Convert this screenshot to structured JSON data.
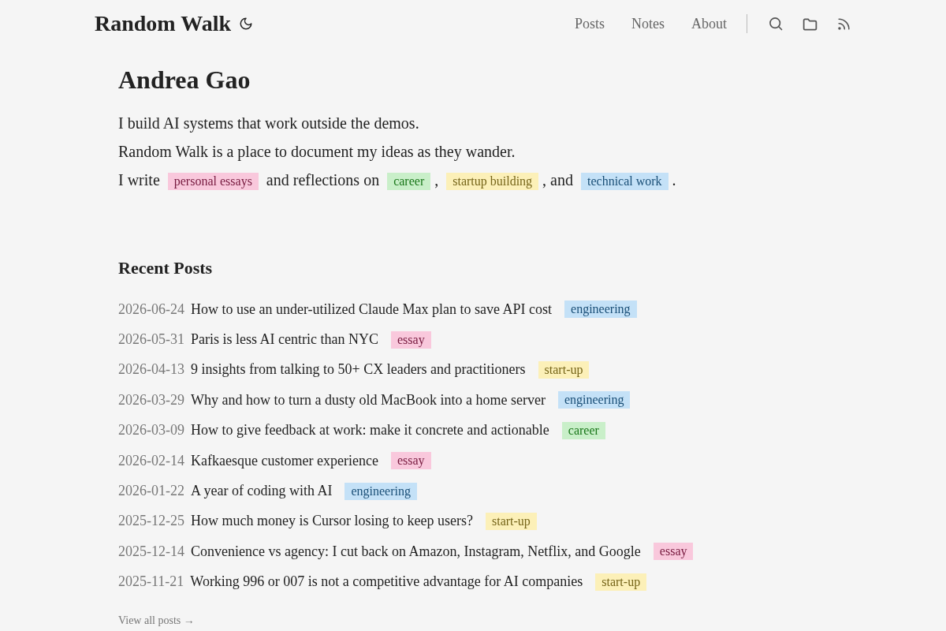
{
  "header": {
    "brand": "Random Walk",
    "nav": [
      {
        "label": "Posts"
      },
      {
        "label": "Notes"
      },
      {
        "label": "About"
      }
    ]
  },
  "profile": {
    "name": "Andrea Gao",
    "intro": [
      {
        "parts": [
          {
            "kind": "text",
            "text": "I build AI systems that work outside the demos."
          }
        ]
      },
      {
        "parts": [
          {
            "kind": "text",
            "text": "Random Walk is a place to document my ideas as they wander."
          }
        ]
      },
      {
        "parts": [
          {
            "kind": "text",
            "text": "I write "
          },
          {
            "kind": "tag",
            "text": "personal essays",
            "color": "#f9c8dc"
          },
          {
            "kind": "text",
            "text": " and reflections on "
          },
          {
            "kind": "tag",
            "text": "career",
            "color": "#c9efc9"
          },
          {
            "kind": "text",
            "text": ", "
          },
          {
            "kind": "tag",
            "text": "startup building",
            "color": "#fcf0b8"
          },
          {
            "kind": "text",
            "text": ", and "
          },
          {
            "kind": "tag",
            "text": "technical work",
            "color": "#c4e1f7"
          },
          {
            "kind": "text",
            "text": "."
          }
        ]
      }
    ]
  },
  "recent_posts": {
    "title": "Recent Posts",
    "posts": [
      {
        "date": "2026-06-24",
        "title": "How to use an under-utilized Claude Max plan to save API cost",
        "tag": {
          "text": "engineering",
          "color": "#c4e1f7"
        }
      },
      {
        "date": "2026-05-31",
        "title": "Paris is less AI centric than NYC",
        "tag": {
          "text": "essay",
          "color": "#f9c8dc"
        }
      },
      {
        "date": "2026-04-13",
        "title": "9 insights from talking to 50+ CX leaders and practitioners",
        "tag": {
          "text": "start-up",
          "color": "#fcf0b8"
        }
      },
      {
        "date": "2026-03-29",
        "title": "Why and how to turn a dusty old MacBook into a home server",
        "tag": {
          "text": "engineering",
          "color": "#c4e1f7"
        }
      },
      {
        "date": "2026-03-09",
        "title": "How to give feedback at work: make it concrete and actionable",
        "tag": {
          "text": "career",
          "color": "#c9efc9"
        }
      },
      {
        "date": "2026-02-14",
        "title": "Kafkaesque customer experience",
        "tag": {
          "text": "essay",
          "color": "#f9c8dc"
        }
      },
      {
        "date": "2026-01-22",
        "title": "A year of coding with AI",
        "tag": {
          "text": "engineering",
          "color": "#c4e1f7"
        }
      },
      {
        "date": "2025-12-25",
        "title": "How much money is Cursor losing to keep users?",
        "tag": {
          "text": "start-up",
          "color": "#fcf0b8"
        }
      },
      {
        "date": "2025-12-14",
        "title": "Convenience vs agency: I cut back on Amazon, Instagram, Netflix, and Google",
        "tag": {
          "text": "essay",
          "color": "#f9c8dc"
        }
      },
      {
        "date": "2025-11-21",
        "title": "Working 996 or 007 is not a competitive advantage for AI companies",
        "tag": {
          "text": "start-up",
          "color": "#fcf0b8"
        }
      }
    ],
    "view_all": "View all posts →"
  }
}
